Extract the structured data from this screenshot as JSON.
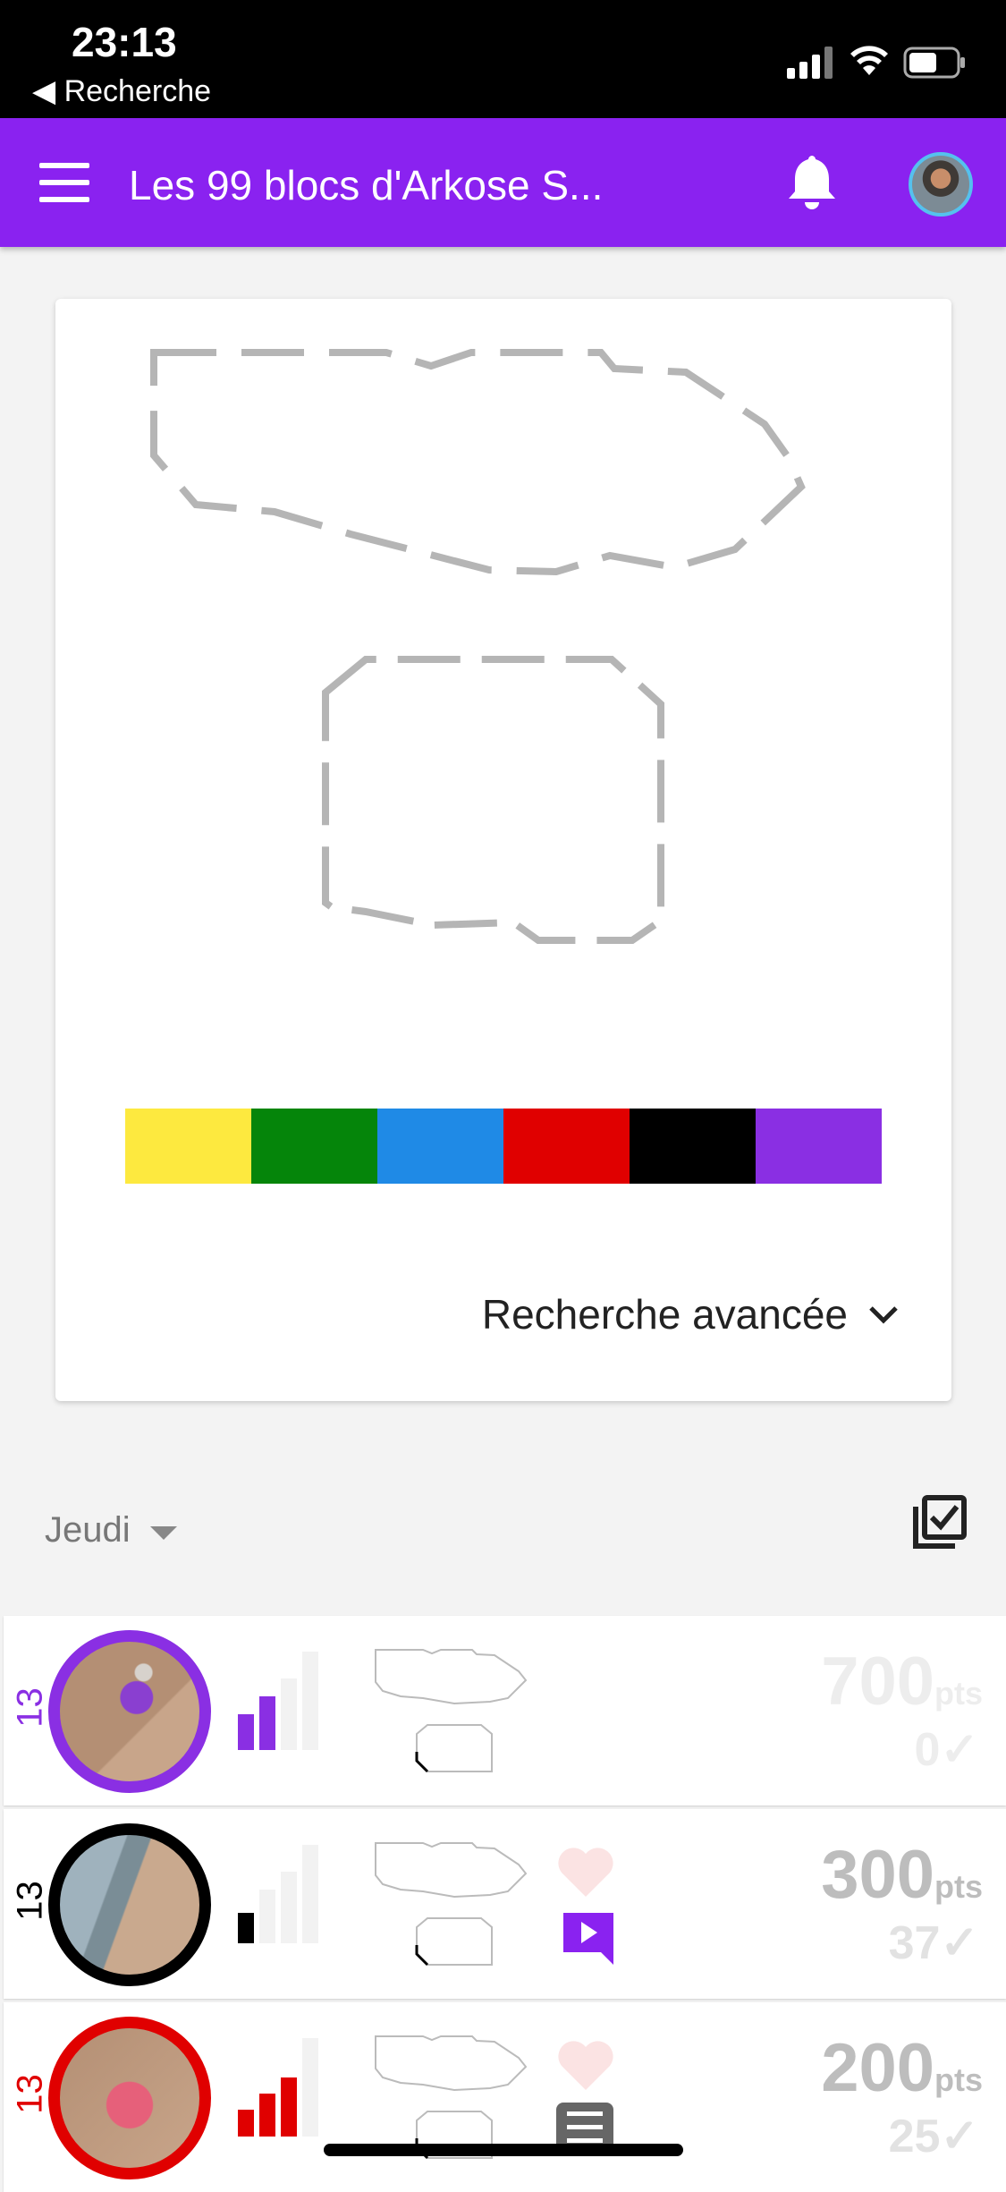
{
  "status": {
    "time": "23:13",
    "back_label": "Recherche"
  },
  "appbar": {
    "title": "Les 99 blocs d'Arkose S..."
  },
  "colors": {
    "accent": "#8a22f0",
    "swatches": [
      "#fde93f",
      "#05850a",
      "#1f8ae6",
      "#e00000",
      "#000000",
      "#8a2fe3"
    ]
  },
  "card": {
    "advanced_search": "Recherche avancée"
  },
  "filter": {
    "day": "Jeudi"
  },
  "problems": [
    {
      "number": "13",
      "color": "#8a2fe3",
      "level_bars": 2,
      "points": "700",
      "unit": "pts",
      "ascents": "0",
      "faded": true
    },
    {
      "number": "13",
      "color": "#000000",
      "level_bars": 1,
      "points": "300",
      "unit": "pts",
      "ascents": "37",
      "faded": false
    },
    {
      "number": "13",
      "color": "#e00000",
      "level_bars": 3,
      "points": "200",
      "unit": "pts",
      "ascents": "25",
      "faded": false
    }
  ]
}
